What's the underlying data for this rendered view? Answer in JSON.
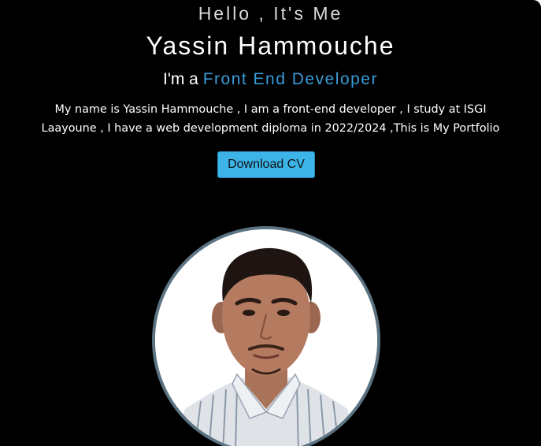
{
  "hero": {
    "greeting": "Hello , It's Me",
    "name": "Yassin Hammouche",
    "role_prefix": "I'm a",
    "role_title": "Front End Developer",
    "bio_line1": "My name is Yassin Hammouche , I am a front-end developer , I study at ISGI",
    "bio_line2": "Laayoune , I have a web development diploma in 2022/2024 ,This is My Portfolio",
    "cv_button": "Download CV"
  },
  "colors": {
    "background": "#000000",
    "accent": "#3a9bd9",
    "button": "#3cb4e8",
    "avatar_border": "#5b7382"
  },
  "avatar": {
    "icon": "profile-photo"
  }
}
